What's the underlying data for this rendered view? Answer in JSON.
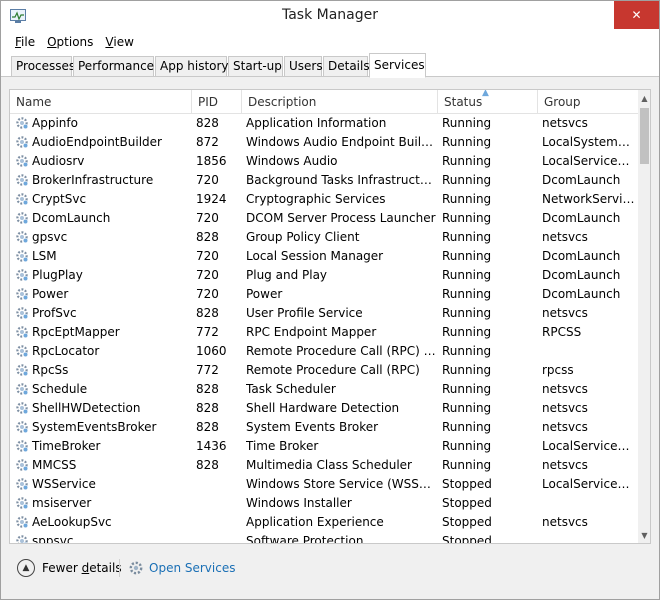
{
  "window": {
    "title": "Task Manager",
    "close_glyph": "✕",
    "app_icon": "task-manager-icon"
  },
  "menu": [
    {
      "label": "File",
      "access": "F",
      "rest": "ile"
    },
    {
      "label": "Options",
      "access": "O",
      "rest": "ptions"
    },
    {
      "label": "View",
      "access": "V",
      "rest": "iew"
    }
  ],
  "tabs": [
    {
      "label": "Processes"
    },
    {
      "label": "Performance"
    },
    {
      "label": "App history"
    },
    {
      "label": "Start-up"
    },
    {
      "label": "Users"
    },
    {
      "label": "Details"
    },
    {
      "label": "Services",
      "active": true
    }
  ],
  "columns": [
    "Name",
    "PID",
    "Description",
    "Status",
    "Group"
  ],
  "sorted_column": "Status",
  "services": [
    {
      "name": "Appinfo",
      "pid": "828",
      "description": "Application Information",
      "status": "Running",
      "group": "netsvcs"
    },
    {
      "name": "AudioEndpointBuilder",
      "pid": "872",
      "description": "Windows Audio Endpoint Builder",
      "status": "Running",
      "group": "LocalSystemN..."
    },
    {
      "name": "Audiosrv",
      "pid": "1856",
      "description": "Windows Audio",
      "status": "Running",
      "group": "LocalServiceN..."
    },
    {
      "name": "BrokerInfrastructure",
      "pid": "720",
      "description": "Background Tasks Infrastructure ...",
      "status": "Running",
      "group": "DcomLaunch"
    },
    {
      "name": "CryptSvc",
      "pid": "1924",
      "description": "Cryptographic Services",
      "status": "Running",
      "group": "NetworkService"
    },
    {
      "name": "DcomLaunch",
      "pid": "720",
      "description": "DCOM Server Process Launcher",
      "status": "Running",
      "group": "DcomLaunch"
    },
    {
      "name": "gpsvc",
      "pid": "828",
      "description": "Group Policy Client",
      "status": "Running",
      "group": "netsvcs"
    },
    {
      "name": "LSM",
      "pid": "720",
      "description": "Local Session Manager",
      "status": "Running",
      "group": "DcomLaunch"
    },
    {
      "name": "PlugPlay",
      "pid": "720",
      "description": "Plug and Play",
      "status": "Running",
      "group": "DcomLaunch"
    },
    {
      "name": "Power",
      "pid": "720",
      "description": "Power",
      "status": "Running",
      "group": "DcomLaunch"
    },
    {
      "name": "ProfSvc",
      "pid": "828",
      "description": "User Profile Service",
      "status": "Running",
      "group": "netsvcs"
    },
    {
      "name": "RpcEptMapper",
      "pid": "772",
      "description": "RPC Endpoint Mapper",
      "status": "Running",
      "group": "RPCSS"
    },
    {
      "name": "RpcLocator",
      "pid": "1060",
      "description": "Remote Procedure Call (RPC) Lo...",
      "status": "Running",
      "group": ""
    },
    {
      "name": "RpcSs",
      "pid": "772",
      "description": "Remote Procedure Call (RPC)",
      "status": "Running",
      "group": "rpcss"
    },
    {
      "name": "Schedule",
      "pid": "828",
      "description": "Task Scheduler",
      "status": "Running",
      "group": "netsvcs"
    },
    {
      "name": "ShellHWDetection",
      "pid": "828",
      "description": "Shell Hardware Detection",
      "status": "Running",
      "group": "netsvcs"
    },
    {
      "name": "SystemEventsBroker",
      "pid": "828",
      "description": "System Events Broker",
      "status": "Running",
      "group": "netsvcs"
    },
    {
      "name": "TimeBroker",
      "pid": "1436",
      "description": "Time Broker",
      "status": "Running",
      "group": "LocalServiceA..."
    },
    {
      "name": "MMCSS",
      "pid": "828",
      "description": "Multimedia Class Scheduler",
      "status": "Running",
      "group": "netsvcs"
    },
    {
      "name": "WSService",
      "pid": "",
      "description": "Windows Store Service (WSServi...",
      "status": "Stopped",
      "group": "LocalServiceA..."
    },
    {
      "name": "msiserver",
      "pid": "",
      "description": "Windows Installer",
      "status": "Stopped",
      "group": ""
    },
    {
      "name": "AeLookupSvc",
      "pid": "",
      "description": "Application Experience",
      "status": "Stopped",
      "group": "netsvcs"
    },
    {
      "name": "sppsvc",
      "pid": "",
      "description": "Software Protection",
      "status": "Stopped",
      "group": ""
    }
  ],
  "footer": {
    "fewer_details": "Fewer details",
    "fewer_access": "d",
    "open_services": "Open Services"
  }
}
